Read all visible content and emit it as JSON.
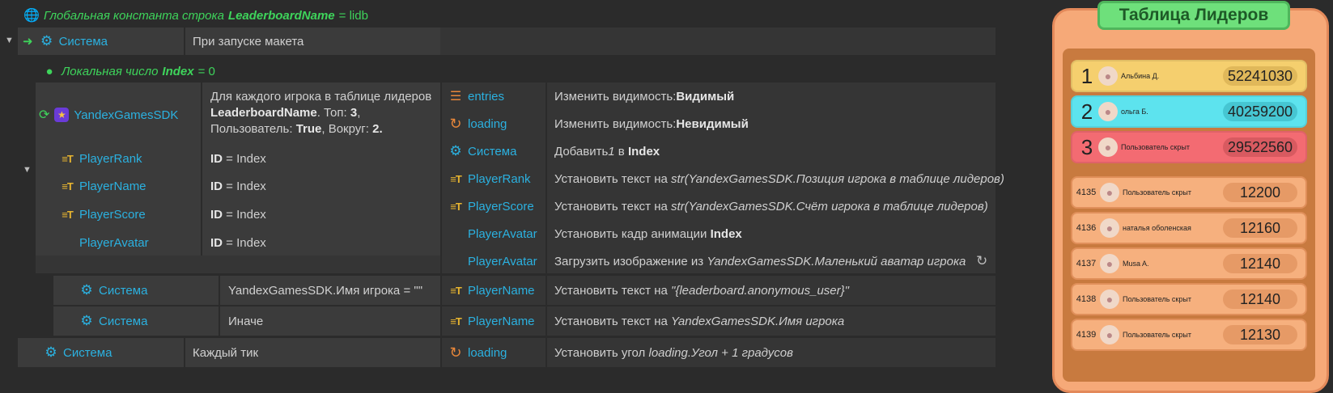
{
  "global": {
    "prefix": "Глобальная константа строка",
    "name": "LeaderboardName",
    "value": "= lidb"
  },
  "event1": {
    "object": "Система",
    "condition": "При запуске макета"
  },
  "local": {
    "prefix": "Локальная число",
    "name": "Index",
    "value": "= 0"
  },
  "foreach": {
    "object": "YandexGamesSDK",
    "line1": "Для каждого игрока в таблице лидеров",
    "line2_bold": "LeaderboardName",
    "line2_rest": ". Топ: ",
    "top": "3",
    "line3_pre": "Пользователь: ",
    "user": "True",
    "line3_mid": ", Вокруг: ",
    "around": "2."
  },
  "pick_conditions": [
    {
      "object": "PlayerRank",
      "key": "ID",
      "value": "= Index"
    },
    {
      "object": "PlayerName",
      "key": "ID",
      "value": "= Index"
    },
    {
      "object": "PlayerScore",
      "key": "ID",
      "value": "= Index"
    },
    {
      "object": "PlayerAvatar",
      "key": "ID",
      "value": "= Index"
    }
  ],
  "actions_main": [
    {
      "object": "entries",
      "icon": "tilemap-icon",
      "pre": "Изменить видимость: ",
      "bold": "Видимый",
      "italic": "",
      "post": ""
    },
    {
      "object": "loading",
      "icon": "loading-icon",
      "pre": "Изменить видимость: ",
      "bold": "Невидимый",
      "italic": "",
      "post": ""
    },
    {
      "object": "Система",
      "icon": "gear-icon",
      "pre": "Добавить ",
      "italic": "1",
      "mid": " в ",
      "bold": "Index"
    },
    {
      "object": "PlayerRank",
      "icon": "text-icon",
      "pre": "Установить текст на ",
      "italic": "str(YandexGamesSDK.Позиция игрока в таблице лидеров)"
    },
    {
      "object": "PlayerScore",
      "icon": "text-icon",
      "pre": "Установить текст на ",
      "italic": "str(YandexGamesSDK.Счёт игрока в таблице лидеров)"
    },
    {
      "object": "PlayerAvatar",
      "icon": "",
      "pre": "Установить кадр анимации ",
      "bold": "Index"
    },
    {
      "object": "PlayerAvatar",
      "icon": "",
      "pre": "Загрузить изображение из ",
      "italic": "YandexGamesSDK.Маленький аватар игрока"
    }
  ],
  "sub_if": {
    "object": "Система",
    "condition": "YandexGamesSDK.Имя игрока = \"\"",
    "action_object": "PlayerName",
    "action_pre": "Установить текст на ",
    "action_italic": "\"{leaderboard.anonymous_user}\""
  },
  "sub_else": {
    "object": "Система",
    "condition": "Иначе",
    "action_object": "PlayerName",
    "action_pre": "Установить текст на ",
    "action_italic": "YandexGamesSDK.Имя игрока"
  },
  "tick": {
    "object": "Система",
    "condition": "Каждый тик",
    "action_object": "loading",
    "action_pre": "Установить угол ",
    "action_italic": "loading.Угол + 1 градусов"
  },
  "leaderboard": {
    "title": "Таблица Лидеров",
    "top": [
      {
        "rank": "1",
        "name": "Альбина Д.",
        "score": "52241030",
        "color": "#f5cf6e",
        "pill": "#e0b85a"
      },
      {
        "rank": "2",
        "name": "ольга Б.",
        "score": "40259200",
        "color": "#5de3ee",
        "pill": "#46c6d2"
      },
      {
        "rank": "3",
        "name": "Пользователь скрыт",
        "score": "29522560",
        "color": "#f36b72",
        "pill": "#d85a60"
      }
    ],
    "around": [
      {
        "rank": "4135",
        "name": "Пользователь скрыт",
        "score": "12200"
      },
      {
        "rank": "4136",
        "name": "наталья оболенская",
        "score": "12160"
      },
      {
        "rank": "4137",
        "name": "Musa A.",
        "score": "12140"
      },
      {
        "rank": "4138",
        "name": "Пользователь скрыт",
        "score": "12140"
      },
      {
        "rank": "4139",
        "name": "Пользователь скрыт",
        "score": "12130"
      }
    ],
    "around_color": "#f6b07e",
    "around_pill": "#e69a66"
  },
  "colors": {
    "keyword": "#3ed45b",
    "object": "#2bb1e0",
    "text_icon": "#e8b530",
    "loading": "#e8873a"
  }
}
